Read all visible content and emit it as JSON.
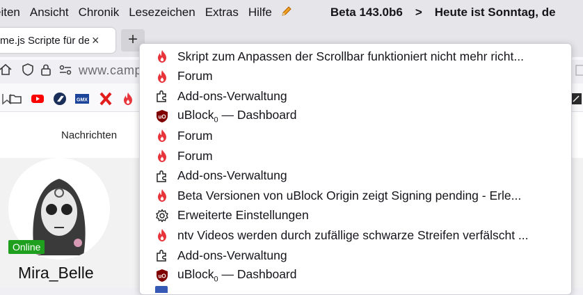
{
  "menubar": {
    "items": [
      "eiten",
      "Ansicht",
      "Chronik",
      "Lesezeichen",
      "Extras",
      "Hilfe"
    ],
    "beta": "Beta 143.0b6",
    "separator": ">",
    "today": "Heute ist  Sonntag, de"
  },
  "tab": {
    "title": "me.js Scripte für de",
    "close": "×",
    "new_tab": "+"
  },
  "urlbar": {
    "text": "www.camp"
  },
  "page": {
    "nav_label": "Nachrichten",
    "status_badge": "Online",
    "username": "Mira_Belle"
  },
  "dropdown": {
    "items": [
      {
        "icon": "flame-icon",
        "label": "Skript zum Anpassen der Scrollbar funktioniert nicht mehr richt..."
      },
      {
        "icon": "flame-icon",
        "label": "Forum"
      },
      {
        "icon": "puzzle-icon",
        "label": "Add-ons-Verwaltung"
      },
      {
        "icon": "ublock-icon",
        "label": "uBlock",
        "sub": "0",
        "suffix": " — Dashboard"
      },
      {
        "icon": "flame-icon",
        "label": "Forum"
      },
      {
        "icon": "flame-icon",
        "label": "Forum"
      },
      {
        "icon": "puzzle-icon",
        "label": "Add-ons-Verwaltung"
      },
      {
        "icon": "flame-icon",
        "label": "Beta Versionen von uBlock Origin zeigt Signing pending - Erle..."
      },
      {
        "icon": "gear-icon",
        "label": "Erweiterte Einstellungen"
      },
      {
        "icon": "flame-icon",
        "label": "ntv Videos werden durch zufällige schwarze Streifen verfälscht ..."
      },
      {
        "icon": "puzzle-icon",
        "label": "Add-ons-Verwaltung"
      },
      {
        "icon": "ublock-icon",
        "label": "uBlock",
        "sub": "0",
        "suffix": " — Dashboard"
      }
    ]
  },
  "colors": {
    "flame": "#e8343b",
    "ublock": "#800000",
    "online": "#1ea01e"
  }
}
